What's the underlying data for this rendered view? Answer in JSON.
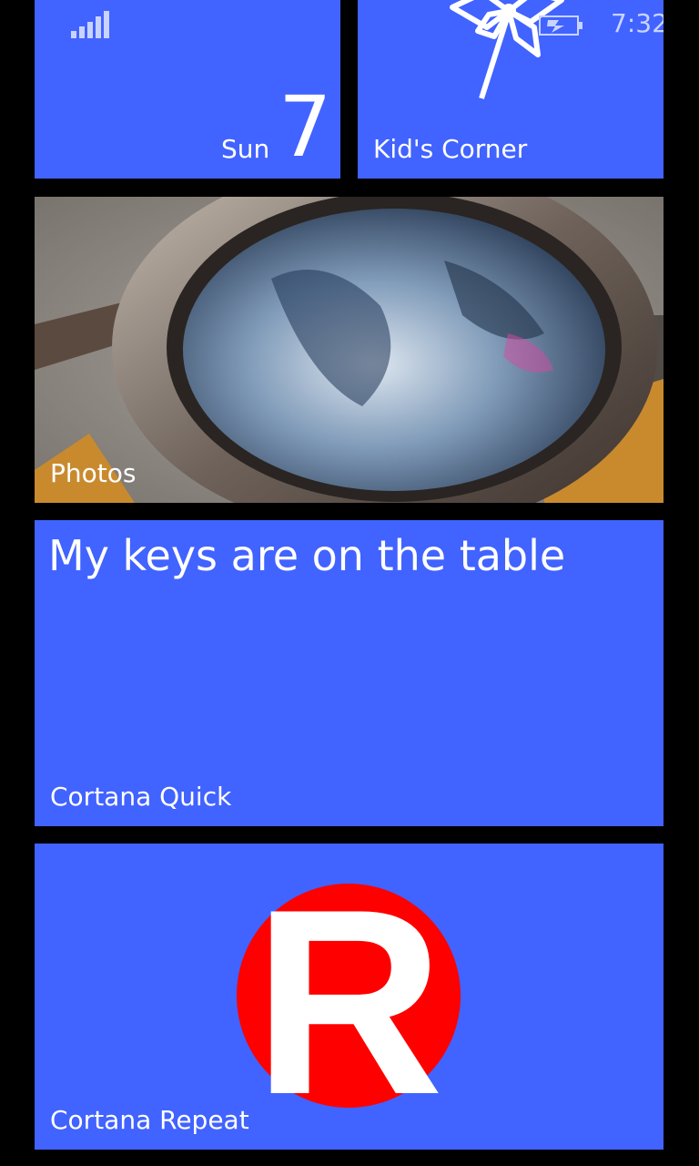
{
  "status_bar": {
    "signal_icon": "signal-strength-icon",
    "battery_icon": "battery-charging-icon",
    "time": "7:32"
  },
  "tiles": {
    "calendar": {
      "day": "Sun",
      "date": "7"
    },
    "kids_corner": {
      "label": "Kid's Corner",
      "icon": "pinwheel-icon"
    },
    "photos": {
      "label": "Photos"
    },
    "cortana_quick": {
      "content": "My keys are on the table",
      "label": "Cortana Quick"
    },
    "cortana_repeat": {
      "label": "Cortana Repeat",
      "logo_letter": "R",
      "logo_icon": "red-circle-r-logo"
    }
  },
  "colors": {
    "tile_accent": "#4163ff",
    "background": "#000000",
    "logo_red": "#ff0000"
  }
}
